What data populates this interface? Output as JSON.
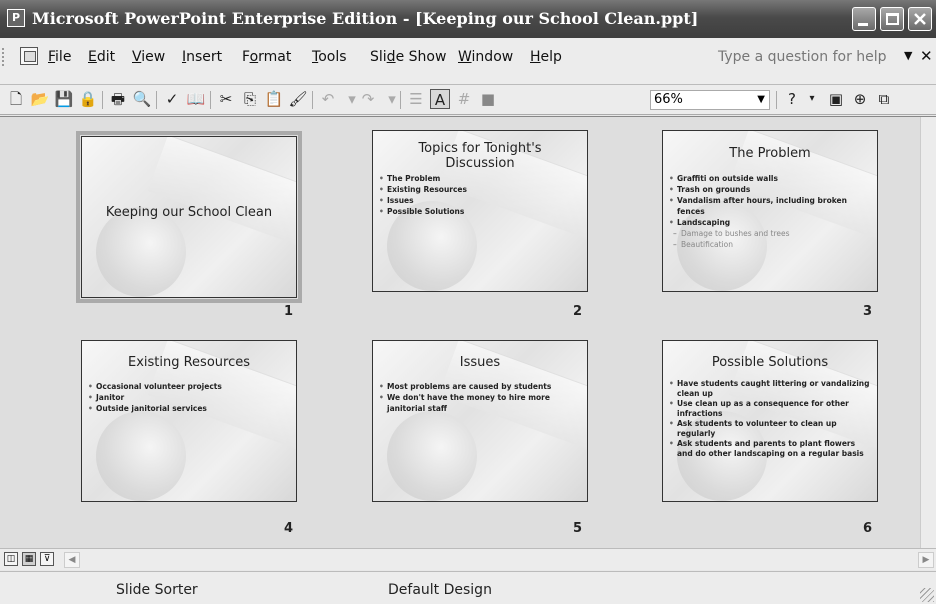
{
  "window": {
    "title": "Microsoft PowerPoint Enterprise Edition - [Keeping our School Clean.ppt]"
  },
  "menu": {
    "items": [
      {
        "label": "File",
        "accel": "F",
        "rest": "ile"
      },
      {
        "label": "Edit",
        "accel": "E",
        "rest": "dit"
      },
      {
        "label": "View",
        "accel": "V",
        "rest": "iew"
      },
      {
        "label": "Insert",
        "accel": "I",
        "rest": "nsert"
      },
      {
        "label": "Format",
        "pre": "F",
        "accel": "o",
        "rest": "rmat"
      },
      {
        "label": "Tools",
        "accel": "T",
        "rest": "ools"
      },
      {
        "label": "Slide Show",
        "pre": "Sli",
        "accel": "d",
        "rest": "e Show"
      },
      {
        "label": "Window",
        "accel": "W",
        "rest": "indow"
      },
      {
        "label": "Help",
        "accel": "H",
        "rest": "elp"
      }
    ],
    "help_placeholder": "Type a question for help"
  },
  "toolbar": {
    "zoom": "66%"
  },
  "slides": [
    {
      "number": "1",
      "title": "Keeping our School Clean",
      "bullets": [],
      "selected": true
    },
    {
      "number": "2",
      "title": "Topics for Tonight's Discussion",
      "bullets": [
        "The Problem",
        "Existing Resources",
        "Issues",
        "Possible Solutions"
      ]
    },
    {
      "number": "3",
      "title": "The Problem",
      "bullets": [
        "Graffiti on outside walls",
        "Trash on grounds",
        "Vandalism after hours, including broken fences",
        "Landscaping"
      ],
      "sub_bullets": [
        "Damage to bushes and trees",
        "Beautification"
      ]
    },
    {
      "number": "4",
      "title": "Existing Resources",
      "bullets": [
        "Occasional volunteer projects",
        "Janitor",
        "Outside janitorial services"
      ]
    },
    {
      "number": "5",
      "title": "Issues",
      "bullets": [
        "Most problems are caused by students",
        "We don't have the money to hire more janitorial staff"
      ]
    },
    {
      "number": "6",
      "title": "Possible Solutions",
      "bullets": [
        "Have students caught littering or vandalizing clean up",
        "Use clean up as a consequence for other infractions",
        "Ask students to volunteer to clean up regularly",
        "Ask students and parents to plant flowers and do other landscaping on a regular basis"
      ]
    }
  ],
  "status": {
    "view": "Slide Sorter",
    "design": "Default Design"
  }
}
